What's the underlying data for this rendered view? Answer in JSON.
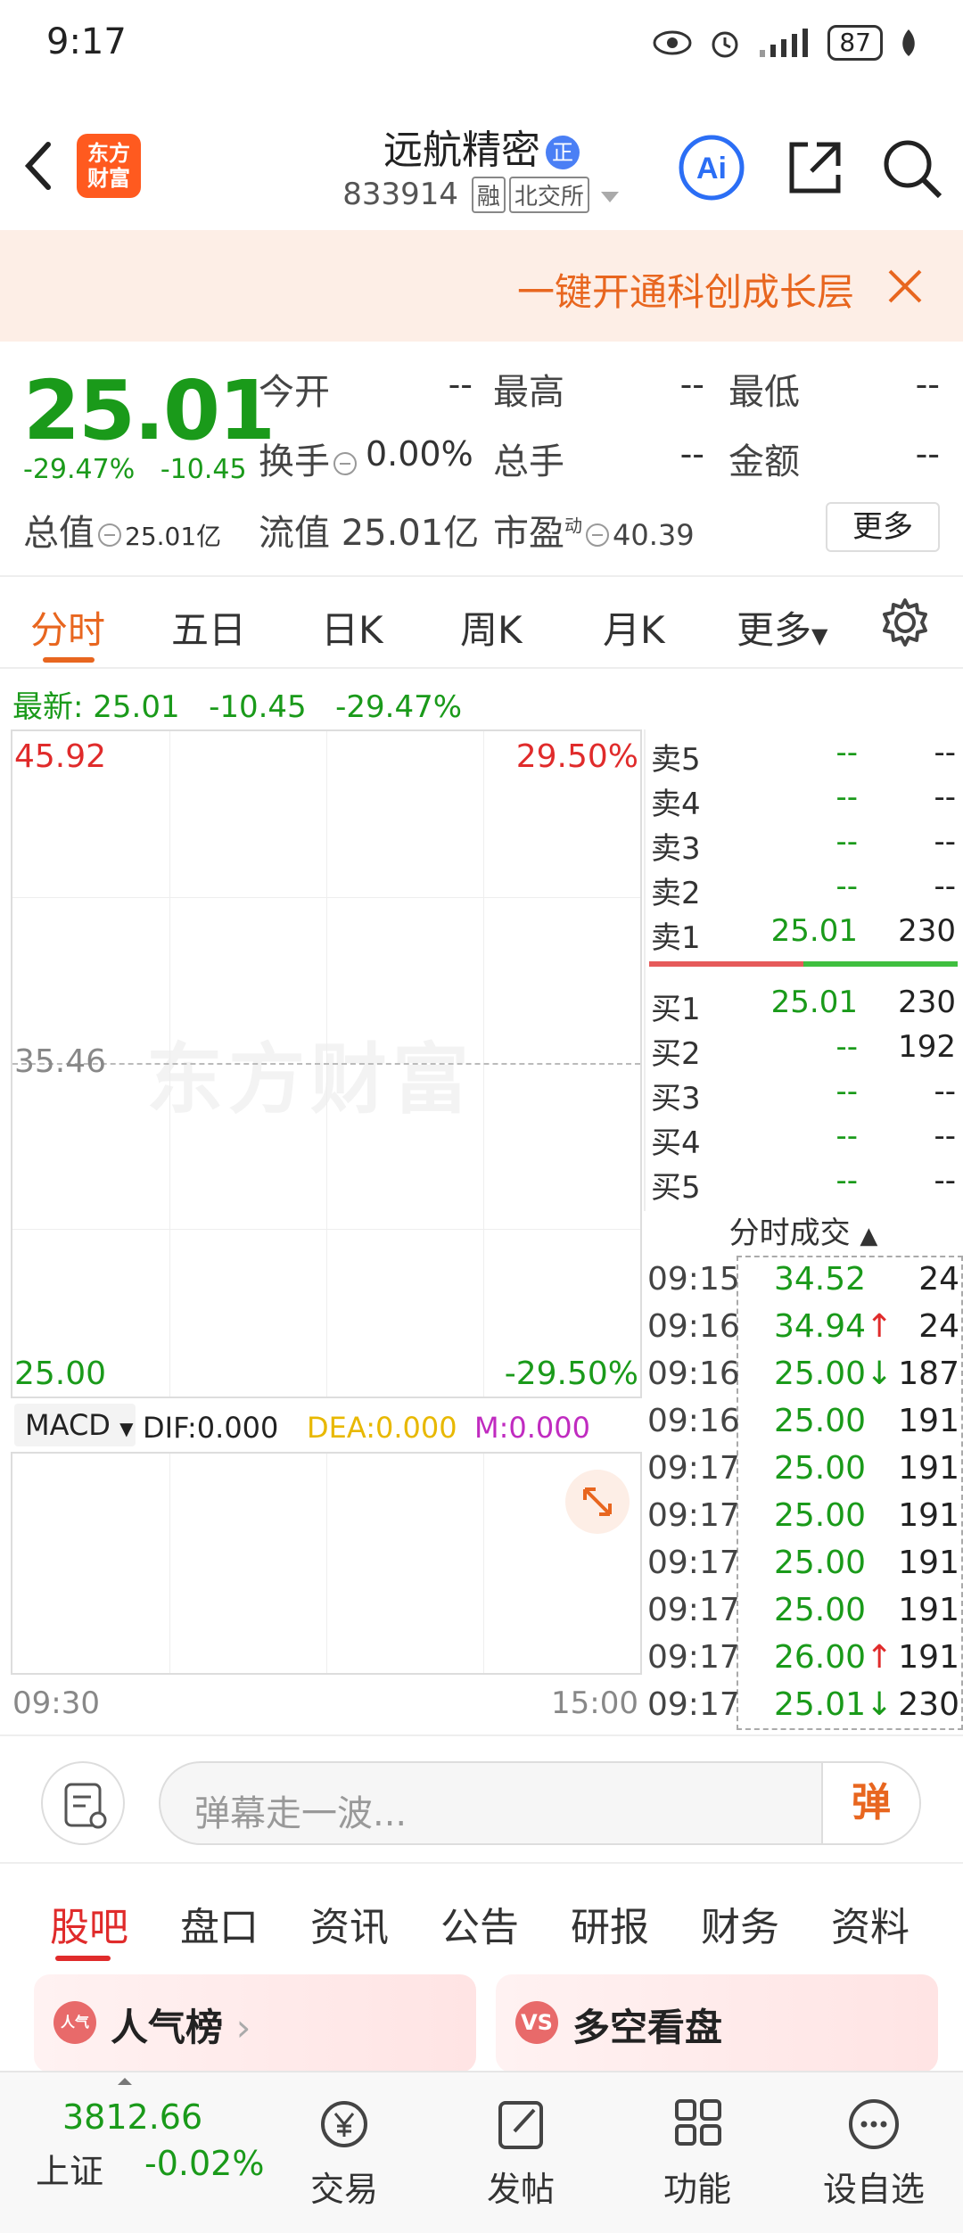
{
  "status_bar": {
    "time": "9:17",
    "battery": "87"
  },
  "header": {
    "logo_text": "东方\n财富",
    "stock_name": "远航精密",
    "name_badge": "正",
    "code": "833914",
    "tag_margin": "融",
    "tag_exchange": "北交所",
    "ai_label": "Ai"
  },
  "banner": {
    "text": "一键开通科创成长层"
  },
  "quote": {
    "price": "25.01",
    "change_pct": "-29.47%",
    "change_abs": "-10.45",
    "open_label": "今开",
    "open_value": "--",
    "high_label": "最高",
    "high_value": "--",
    "low_label": "最低",
    "low_value": "--",
    "turnover_label": "换手",
    "turnover_value": "0.00%",
    "volume_label": "总手",
    "volume_value": "--",
    "amount_label": "金额",
    "amount_value": "--",
    "total_cap_label": "总值",
    "total_cap_value": "25.01亿",
    "float_cap_label": "流值",
    "float_cap_value": "25.01亿",
    "pe_label": "市盈",
    "pe_superscript": "动",
    "pe_value": "40.39",
    "more_label": "更多"
  },
  "tabs": [
    "分时",
    "五日",
    "日K",
    "周K",
    "月K",
    "更多"
  ],
  "latest": {
    "label": "最新:",
    "price": "25.01",
    "change": "-10.45",
    "pct": "-29.47%"
  },
  "chart": {
    "top_price": "45.92",
    "top_pct": "29.50%",
    "mid_price": "35.46",
    "bottom_price": "25.00",
    "bottom_pct": "-29.50%",
    "watermark": "东方财富",
    "time_start": "09:30",
    "time_end": "15:00"
  },
  "macd": {
    "selector": "MACD",
    "dif": "DIF:0.000",
    "dea": "DEA:0.000",
    "m": "M:0.000"
  },
  "order_book": {
    "asks": [
      {
        "label": "卖5",
        "price": "--",
        "volume": "--"
      },
      {
        "label": "卖4",
        "price": "--",
        "volume": "--"
      },
      {
        "label": "卖3",
        "price": "--",
        "volume": "--"
      },
      {
        "label": "卖2",
        "price": "--",
        "volume": "--"
      },
      {
        "label": "卖1",
        "price": "25.01",
        "volume": "230"
      }
    ],
    "bids": [
      {
        "label": "买1",
        "price": "25.01",
        "volume": "230"
      },
      {
        "label": "买2",
        "price": "--",
        "volume": "192"
      },
      {
        "label": "买3",
        "price": "--",
        "volume": "--"
      },
      {
        "label": "买4",
        "price": "--",
        "volume": "--"
      },
      {
        "label": "买5",
        "price": "--",
        "volume": "--"
      }
    ]
  },
  "trades": {
    "title": "分时成交",
    "rows": [
      {
        "time": "09:15",
        "price": "34.52",
        "arrow": "",
        "volume": "24"
      },
      {
        "time": "09:16",
        "price": "34.94",
        "arrow": "↑",
        "volume": "24"
      },
      {
        "time": "09:16",
        "price": "25.00",
        "arrow": "↓",
        "volume": "187"
      },
      {
        "time": "09:16",
        "price": "25.00",
        "arrow": "",
        "volume": "191"
      },
      {
        "time": "09:17",
        "price": "25.00",
        "arrow": "",
        "volume": "191"
      },
      {
        "time": "09:17",
        "price": "25.00",
        "arrow": "",
        "volume": "191"
      },
      {
        "time": "09:17",
        "price": "25.00",
        "arrow": "",
        "volume": "191"
      },
      {
        "time": "09:17",
        "price": "25.00",
        "arrow": "",
        "volume": "191"
      },
      {
        "time": "09:17",
        "price": "26.00",
        "arrow": "↑",
        "volume": "191"
      },
      {
        "time": "09:17",
        "price": "25.01",
        "arrow": "↓",
        "volume": "230"
      }
    ]
  },
  "comment": {
    "placeholder": "弹幕走一波...",
    "danmu_button": "弹"
  },
  "footer_tabs": [
    "股吧",
    "盘口",
    "资讯",
    "公告",
    "研报",
    "财务",
    "资料"
  ],
  "cards": [
    {
      "icon": "人气",
      "label": "人气榜"
    },
    {
      "icon": "VS",
      "label": "多空看盘"
    }
  ],
  "bottom_nav": {
    "index_value": "3812.66",
    "index_name": "上证",
    "index_change": "-0.02%",
    "items": [
      "交易",
      "发帖",
      "功能",
      "设自选"
    ]
  },
  "colors": {
    "up": "#e02b2b",
    "down": "#1a9a1a",
    "accent": "#e8661f"
  }
}
